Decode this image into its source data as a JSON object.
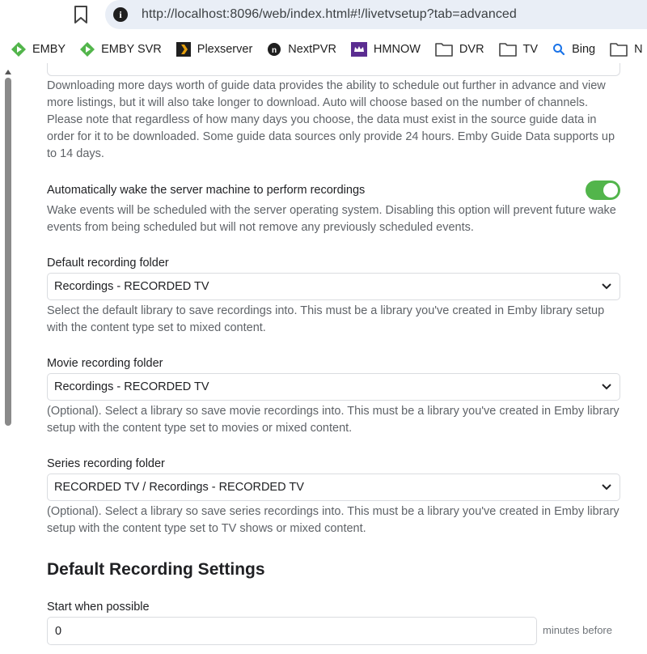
{
  "browser": {
    "url": "http://localhost:8096/web/index.html#!/livetvsetup?tab=advanced",
    "bookmarks": [
      {
        "label": "EMBY",
        "icon": "emby-icon"
      },
      {
        "label": "EMBY SVR",
        "icon": "emby-icon"
      },
      {
        "label": "Plexserver",
        "icon": "plex-icon"
      },
      {
        "label": "NextPVR",
        "icon": "nextpvr-icon"
      },
      {
        "label": "HMNOW",
        "icon": "hmnow-icon"
      },
      {
        "label": "DVR",
        "icon": "folder-icon"
      },
      {
        "label": "TV",
        "icon": "folder-icon"
      },
      {
        "label": "Bing",
        "icon": "bing-search-icon"
      },
      {
        "label": "N",
        "icon": "folder-icon"
      }
    ]
  },
  "guide_days": {
    "description": "Downloading more days worth of guide data provides the ability to schedule out further in advance and view more listings, but it will also take longer to download. Auto will choose based on the number of channels. Please note that regardless of how many days you choose, the data must exist in the source guide data in order for it to be downloaded. Some guide data sources only provide 24 hours. Emby Guide Data supports up to 14 days."
  },
  "wake": {
    "label": "Automatically wake the server machine to perform recordings",
    "enabled": true,
    "description": "Wake events will be scheduled with the server operating system. Disabling this option will prevent future wake events from being scheduled but will not remove any previously scheduled events."
  },
  "default_folder": {
    "label": "Default recording folder",
    "value": "Recordings - RECORDED TV",
    "description": "Select the default library to save recordings into. This must be a library you've created in Emby library setup with the content type set to mixed content."
  },
  "movie_folder": {
    "label": "Movie recording folder",
    "value": "Recordings - RECORDED TV",
    "description": "(Optional). Select a library so save movie recordings into. This must be a library you've created in Emby library setup with the content type set to movies or mixed content."
  },
  "series_folder": {
    "label": "Series recording folder",
    "value": "RECORDED TV / Recordings - RECORDED TV",
    "description": "(Optional). Select a library so save series recordings into. This must be a library you've created in Emby library setup with the content type set to TV shows or mixed content."
  },
  "recording_settings": {
    "heading": "Default Recording Settings",
    "start_label": "Start when possible",
    "start_value": "0",
    "start_suffix": "minutes before"
  },
  "colors": {
    "accent": "#52b54b",
    "omnibox": "#e9eef6"
  }
}
